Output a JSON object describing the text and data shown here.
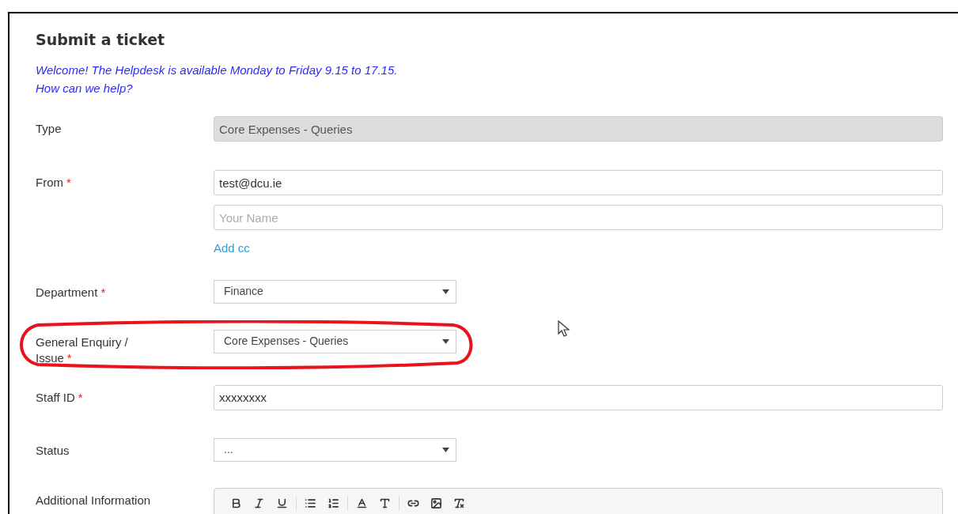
{
  "title": "Submit a ticket",
  "welcome": [
    "Welcome! The Helpdesk is available Monday to Friday 9.15 to 17.15.",
    "How can we help?"
  ],
  "fields": [
    {
      "kind": "text",
      "label": "Type",
      "required": false,
      "disabled": true,
      "highlighted": false,
      "value": "Core Expenses - Queries"
    },
    {
      "kind": "from",
      "label": "From",
      "required": true,
      "disabled": false,
      "highlighted": false,
      "value": "test@dcu.ie",
      "placeholder": "Your Name",
      "link": "Add cc"
    },
    {
      "kind": "select",
      "label": "Department",
      "required": true,
      "disabled": false,
      "highlighted": false,
      "value": "Finance"
    },
    {
      "kind": "select",
      "label": "General Enquiry / Issue",
      "required": true,
      "disabled": false,
      "highlighted": true,
      "value": "Core Expenses - Queries"
    },
    {
      "kind": "text",
      "label": "Staff ID",
      "required": true,
      "disabled": false,
      "highlighted": false,
      "value": "xxxxxxxx"
    },
    {
      "kind": "select",
      "label": "Status",
      "required": false,
      "disabled": false,
      "highlighted": false,
      "value": "..."
    },
    {
      "kind": "editor",
      "label": "Additional Information",
      "required": false,
      "disabled": false,
      "highlighted": false
    }
  ],
  "required_mark": "*"
}
